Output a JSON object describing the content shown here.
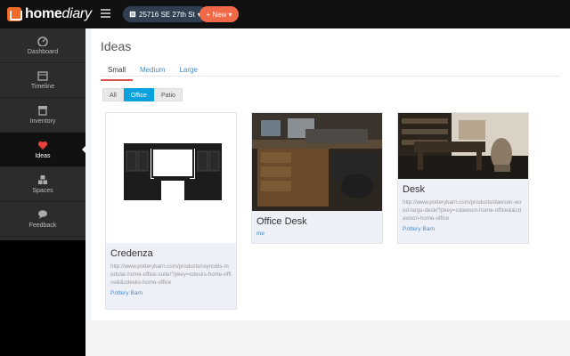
{
  "app": {
    "logo_home": "home",
    "logo_diary": "diary",
    "address": "25716 SE 27th St",
    "new_label": "+ New"
  },
  "sidebar": {
    "items": [
      {
        "label": "Dashboard",
        "icon": "dashboard-icon"
      },
      {
        "label": "Timeline",
        "icon": "calendar-icon"
      },
      {
        "label": "Inventory",
        "icon": "archive-icon"
      },
      {
        "label": "Ideas",
        "icon": "heart-icon",
        "active": true
      },
      {
        "label": "Spaces",
        "icon": "cubes-icon"
      },
      {
        "label": "Feedback",
        "icon": "comment-icon"
      }
    ]
  },
  "page": {
    "title": "Ideas",
    "tabs": [
      "Small",
      "Medium",
      "Large"
    ],
    "active_tab": "Small",
    "filters": [
      "All",
      "Office",
      "Patio"
    ],
    "active_filter": "Office"
  },
  "cards": [
    {
      "name": "Credenza",
      "url": "http://www.potterybarn.com/products/reynolds-modular-home-office-suite/?pkey=cdesks-home-office&&cdesks-home-office",
      "source": "Pottery Barn"
    },
    {
      "name": "Office Desk",
      "url": "",
      "source": "me"
    },
    {
      "name": "Desk",
      "url": "http://www.potterybarn.com/products/dawson-wood-large-desk/?pkey=cdawson-home-office&&cdawson-home-office",
      "source": "Pottery Barn"
    }
  ],
  "colors": {
    "accent_orange": "#f06a4a",
    "accent_blue": "#0aa1dd",
    "link_blue": "#4a8cc6",
    "active_tab_underline": "#d9534f"
  }
}
